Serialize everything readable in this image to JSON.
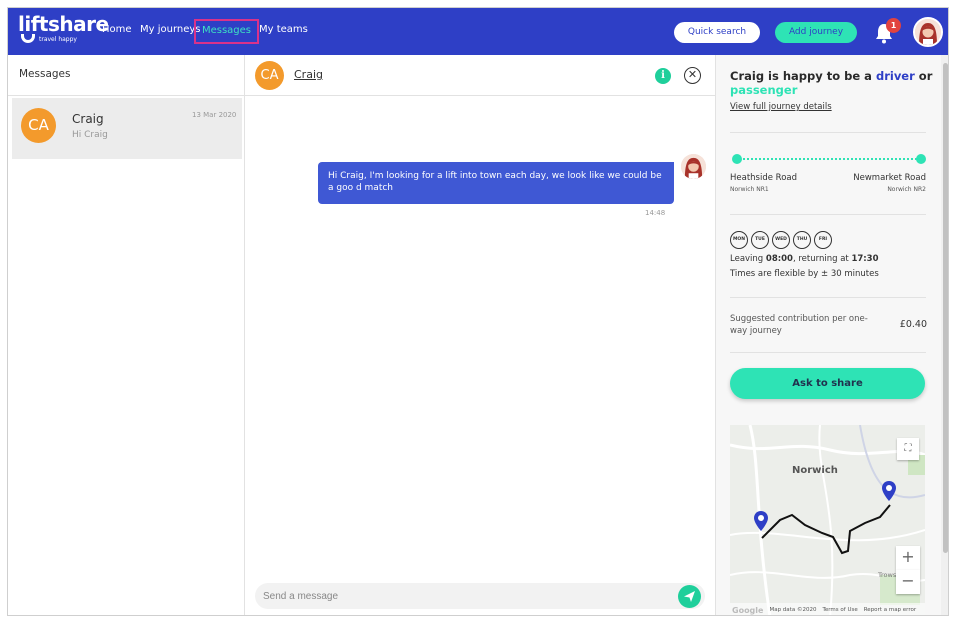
{
  "nav": {
    "logo_text": "liftshare",
    "logo_tagline": "travel happy",
    "home": "Home",
    "journeys": "My journeys",
    "messages": "Messages",
    "teams": "My teams",
    "quick_search": "Quick search",
    "add_journey": "Add journey",
    "notification_count": "1"
  },
  "conversations": {
    "header": "Messages",
    "items": [
      {
        "initials": "CA",
        "name": "Craig",
        "preview": "Hi Craig",
        "date": "13 Mar 2020"
      }
    ]
  },
  "chat": {
    "initials": "CA",
    "name": "Craig",
    "messages": [
      {
        "text": "Hi Craig, I'm looking for a lift into town each day, we look like we could be a goo d match",
        "time": "14:48"
      }
    ],
    "input_placeholder": "Send a message"
  },
  "journey": {
    "title_prefix": "Craig is happy to be a",
    "driver": "driver",
    "or": "or",
    "passenger": "passenger",
    "view_details": "View full journey details",
    "from_name": "Heathside Road",
    "from_sub": "Norwich NR1",
    "to_name": "Newmarket Road",
    "to_sub": "Norwich NR2",
    "days": [
      "MON",
      "TUE",
      "WED",
      "THU",
      "FRI"
    ],
    "leaving_label": "Leaving",
    "leaving_time": "08:00",
    "returning_label": ", returning at",
    "returning_time": "17:30",
    "flexibility": "Times are flexible by ± 30 minutes",
    "contribution_label": "Suggested contribution per one-way journey",
    "contribution_value": "£0.40",
    "ask_button": "Ask to share",
    "map": {
      "city_label": "Norwich",
      "area_label": "Trows Newtc",
      "zoom_in": "+",
      "zoom_out": "−",
      "google": "Google",
      "map_data": "Map data ©2020",
      "terms": "Terms of Use",
      "report": "Report a map error"
    }
  },
  "colors": {
    "brand_blue": "#2e3fc6",
    "accent_green": "#2ee3b5",
    "avatar_orange": "#f39a2c",
    "bubble_blue": "#3f58d4",
    "highlight_pink": "#d9328a"
  },
  "icons": {
    "notification": "bell-icon",
    "info": "info-icon",
    "close": "close-icon",
    "send": "paper-plane-icon",
    "fullscreen": "fullscreen-icon",
    "map_pin": "map-pin-icon"
  }
}
